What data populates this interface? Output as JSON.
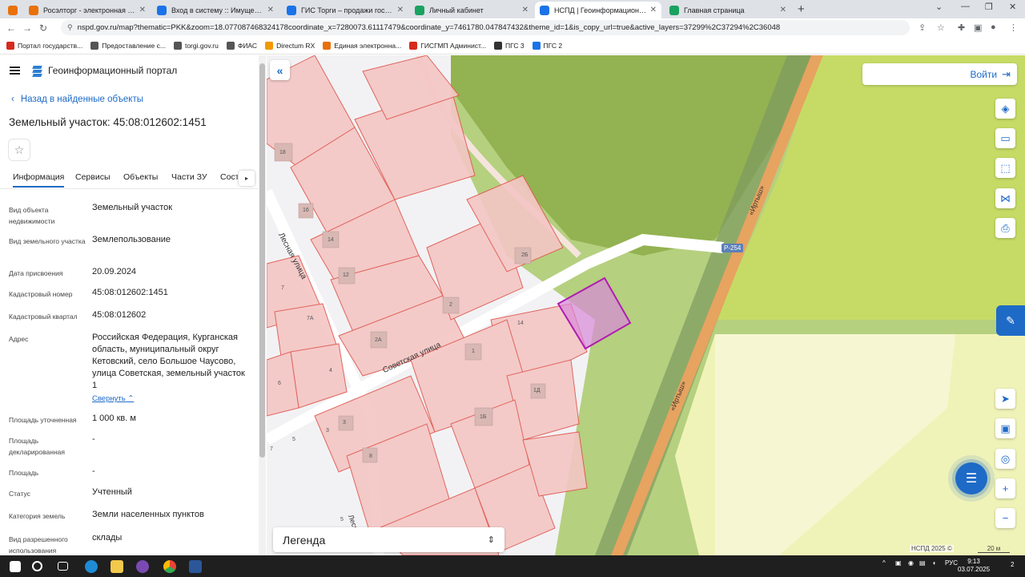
{
  "browser": {
    "tabs": [
      {
        "label": "Росэлторг - электронная торгов",
        "color": "#e8710a",
        "active": false
      },
      {
        "label": "Вход в систему :: Имущественн",
        "color": "#1a73e8",
        "active": false
      },
      {
        "label": "ГИС Торги – продажи государс",
        "color": "#1a73e8",
        "active": false
      },
      {
        "label": "Личный кабинет",
        "color": "#1aa260",
        "active": false
      },
      {
        "label": "НСПД | Геоинформационный п",
        "color": "#1a73e8",
        "active": true
      },
      {
        "label": "Главная страница",
        "color": "#1aa260",
        "active": false
      }
    ],
    "url": "nspd.gov.ru/map?thematic=PKK&zoom=18.077087468324178coordinate_x=7280073.61117479&coordinate_y=7461780.047847432&theme_id=1&is_copy_url=true&active_layers=37299%2C37294%2C36048",
    "bookmarks": [
      {
        "label": "Портал государств...",
        "color": "#d52b1e"
      },
      {
        "label": "Предоставление с...",
        "color": "#555555"
      },
      {
        "label": "torgi.gov.ru",
        "color": "#555555"
      },
      {
        "label": "ФИАС",
        "color": "#555555"
      },
      {
        "label": "Directum RX",
        "color": "#f29900"
      },
      {
        "label": "Единая электронна...",
        "color": "#e8710a"
      },
      {
        "label": "ГИСГМП Админист...",
        "color": "#d52b1e"
      },
      {
        "label": "ПГС 3",
        "color": "#333333"
      },
      {
        "label": "ПГС 2",
        "color": "#1a73e8"
      }
    ]
  },
  "sidebar": {
    "portal_title": "Геоинформационный портал",
    "back_link": "Назад в найденные объекты",
    "object_title": "Земельный участок: 45:08:012602:1451",
    "tabs": [
      "Информация",
      "Сервисы",
      "Объекты",
      "Части ЗУ",
      "Соста"
    ],
    "rows": [
      {
        "label": "Вид объекта недвижимости",
        "value": "Земельный участок"
      },
      {
        "label": "Вид земельного участка",
        "value": "Землепользование"
      },
      {
        "label": "Дата присвоения",
        "value": "20.09.2024"
      },
      {
        "label": "Кадастровый номер",
        "value": "45:08:012602:1451"
      },
      {
        "label": "Кадастровый квартал",
        "value": "45:08:012602"
      },
      {
        "label": "Адрес",
        "value": "Российская Федерация, Курганская область, муниципальный округ Кетовский, село Большое Чаусово, улица Советская, земельный участок 1"
      },
      {
        "label": "Площадь уточненная",
        "value": "1 000 кв. м"
      },
      {
        "label": "Площадь декларированная",
        "value": "-"
      },
      {
        "label": "Площадь",
        "value": "-"
      },
      {
        "label": "Статус",
        "value": "Учтенный"
      },
      {
        "label": "Категория земель",
        "value": "Земли населенных пунктов"
      },
      {
        "label": "Вид разрешенного использования",
        "value": "склады"
      }
    ],
    "collapse_link": "Свернуть"
  },
  "map": {
    "login_label": "Войти",
    "legend_label": "Легенда",
    "road_badge": "Р-254",
    "copyright": "НСПД 2025 ©",
    "scale": "20 м",
    "street_labels": [
      "Советская улица",
      "Лесная улица",
      "«Иртыш»",
      "«Иртыш»",
      "Лесн"
    ],
    "house_numbers": [
      "18",
      "16",
      "14",
      "12",
      "2А",
      "2",
      "2Б",
      "7",
      "7А",
      "4",
      "6",
      "1",
      "1Д",
      "1Б",
      "3",
      "3",
      "5",
      "8",
      "14",
      "7",
      "5"
    ]
  },
  "taskbar": {
    "lang": "РУС",
    "time": "9:13",
    "date": "03.07.2025",
    "notifications": "2"
  },
  "colors": {
    "accent": "#1e6ac7",
    "parcel_fill": "#f4c6c4",
    "parcel_stroke": "#e0554d",
    "selected_parcel": "#b01cb0",
    "green_zone": "#9dc34f",
    "yellow_zone": "#e8f0a0",
    "road": "#e7a360"
  }
}
